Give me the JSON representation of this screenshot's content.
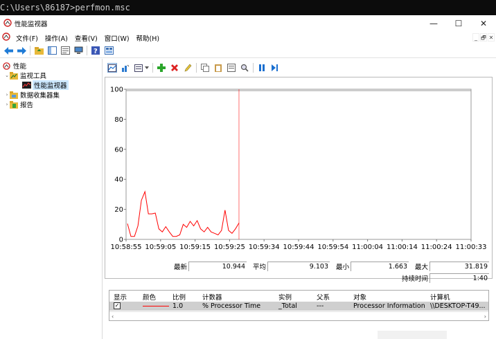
{
  "console": {
    "text": "C:\\Users\\86187>perfmon.msc"
  },
  "window": {
    "title": "性能监视器",
    "minimize": "—",
    "maximize": "☐",
    "close": "✕"
  },
  "menu": {
    "items": [
      "文件(F)",
      "操作(A)",
      "查看(V)",
      "窗口(W)",
      "帮助(H)"
    ],
    "mdi": [
      "_",
      "🗗",
      "✕"
    ]
  },
  "tree": {
    "root": "性能",
    "monitoring_tools": "监视工具",
    "perf_monitor": "性能监视器",
    "data_collector_sets": "数据收集器集",
    "reports": "报告"
  },
  "chart_data": {
    "type": "line",
    "y_ticks": [
      "100",
      "80",
      "60",
      "40",
      "20",
      "0"
    ],
    "ylim": [
      0,
      100
    ],
    "x_ticks": [
      "10:58:55",
      "10:59:05",
      "10:59:15",
      "10:59:25",
      "10:59:34",
      "10:59:44",
      "10:59:54",
      "11:00:04",
      "11:00:14",
      "11:00:24",
      "11:00:33"
    ],
    "series": [
      {
        "name": "% Processor Time",
        "color": "#ff0000",
        "values": [
          10.5,
          2,
          2,
          9,
          26,
          31.8,
          17,
          17,
          17.5,
          7,
          5,
          8.5,
          5,
          2,
          2,
          3,
          10,
          8,
          12,
          9,
          12.5,
          7,
          5,
          8,
          5,
          4,
          3,
          6,
          19.5,
          6,
          4,
          7,
          10.9
        ]
      }
    ],
    "current_time_marker_index": 32,
    "grid": false
  },
  "stats": {
    "last_label": "最新",
    "last": "10.944",
    "avg_label": "平均",
    "avg": "9.103",
    "min_label": "最小",
    "min": "1.663",
    "max_label": "最大",
    "max": "31.819",
    "duration_label": "持续时间",
    "duration": "1:40"
  },
  "legend": {
    "headers": [
      "显示",
      "颜色",
      "比例",
      "计数器",
      "实例",
      "父系",
      "对象",
      "计算机"
    ],
    "row": {
      "checked": "✓",
      "color": "#ff0000",
      "scale": "1.0",
      "counter": "% Processor Time",
      "instance": "_Total",
      "parent": "---",
      "object": "Processor Information",
      "computer": "\\\\DESKTOP-T49..."
    }
  }
}
